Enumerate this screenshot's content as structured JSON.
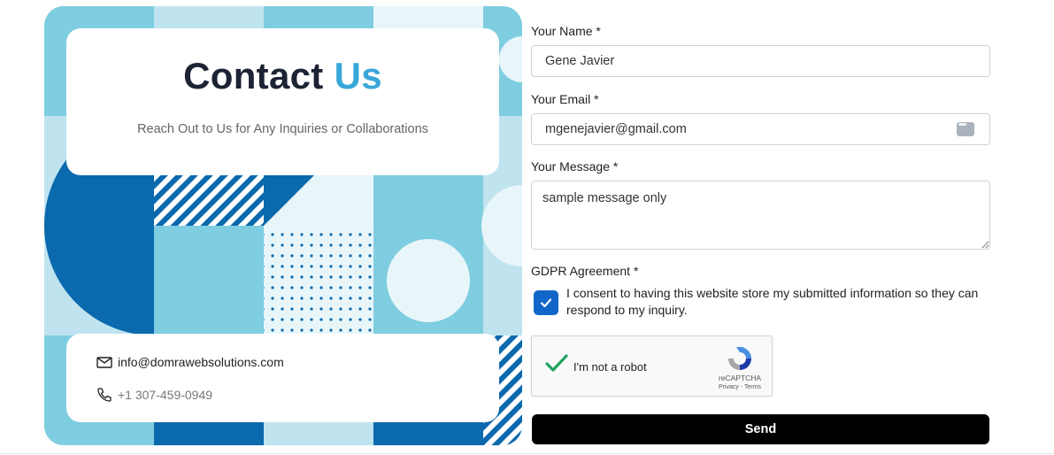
{
  "hero": {
    "title_main": "Contact",
    "title_accent": "Us",
    "subtitle": "Reach Out to Us for Any Inquiries or Collaborations"
  },
  "contact": {
    "email": "info@domrawebsolutions.com",
    "phone": "+1 307-459-0949",
    "email_icon": "mail-icon",
    "phone_icon": "phone-icon"
  },
  "form": {
    "name_label": "Your Name *",
    "name_value": "Gene Javier",
    "email_label": "Your Email *",
    "email_value": "mgenejavier@gmail.com",
    "message_label": "Your Message *",
    "message_value": "sample message only",
    "gdpr_label": "GDPR Agreement *",
    "gdpr_text": "I consent to having this website store my submitted information so they can respond to my inquiry.",
    "gdpr_checked": true,
    "submit_label": "Send"
  },
  "recaptcha": {
    "label": "I'm not a robot",
    "brand": "reCAPTCHA",
    "terms": "Privacy - Terms",
    "checked": true
  },
  "colors": {
    "accent": "#3aa7d9",
    "dark_blue": "#0b69ad",
    "checkbox": "#1366c9",
    "button": "#000000"
  }
}
